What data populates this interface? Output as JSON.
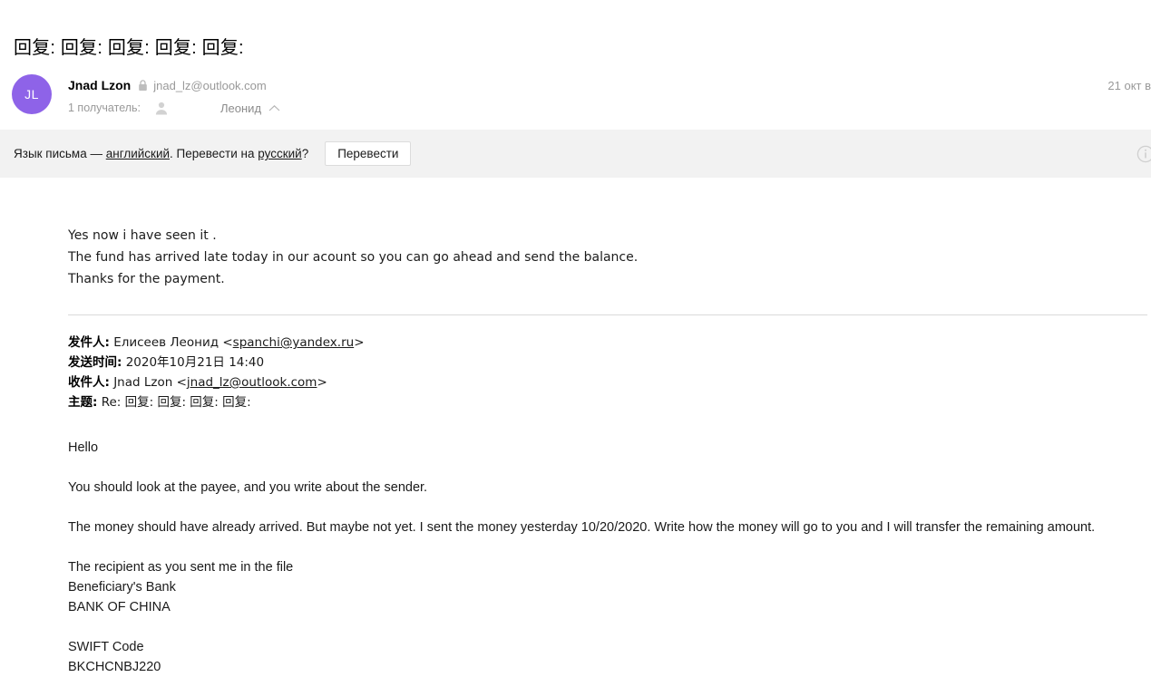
{
  "mail": {
    "subject": "回复: 回复: 回复: 回复: 回复:",
    "date": "21 окт в",
    "sender": {
      "avatar_initials": "JL",
      "avatar_color": "#8e63e8",
      "name": "Jnad Lzon",
      "email": "jnad_lz@outlook.com",
      "lock_icon": "lock-icon"
    },
    "recipients": {
      "label": "1 получатель:",
      "name": "Леонид",
      "avatar_icon": "person-icon",
      "collapse_icon": "chevron-up-icon"
    }
  },
  "translate_banner": {
    "prefix": "Язык письма — ",
    "source_language": "английский",
    "middle": ". Перевести на ",
    "target_language": "русский",
    "suffix": "?",
    "button_label": "Перевести",
    "info_icon": "info-icon",
    "background": "#f2f2f2"
  },
  "reply_body": {
    "lines": [
      "Yes now i have seen it .",
      "The fund has arrived late today in our acount so you can go ahead and send the balance.",
      "Thanks for the payment."
    ]
  },
  "quoted_headers": [
    {
      "key": "发件人:",
      "value_prefix": " Елисеев Леонид <",
      "link": "spanchi@yandex.ru",
      "value_suffix": ">"
    },
    {
      "key": "发送时间:",
      "value_prefix": " 2020年10月21日 14:40",
      "link": "",
      "value_suffix": ""
    },
    {
      "key": "收件人:",
      "value_prefix": " Jnad Lzon <",
      "link": "jnad_lz@outlook.com",
      "value_suffix": ">"
    },
    {
      "key": "主题:",
      "value_prefix": " Re: 回复: 回复: 回复: 回复:",
      "link": "",
      "value_suffix": ""
    }
  ],
  "quoted_body": {
    "greeting": "Hello",
    "paragraph_1": "You should look at the payee, and you write about the sender.",
    "paragraph_2": "The money should have already arrived. But maybe not yet. I sent the money yesterday 10/20/2020. Write how the money will go to you and I will transfer the remaining amount.",
    "recipient_line": "The recipient as you sent me in the file",
    "bank_label": "Beneficiary's Bank",
    "bank_name": "BANK OF CHINA",
    "swift_label": "SWIFT Code",
    "swift_code": "BKCHCNBJ220"
  }
}
